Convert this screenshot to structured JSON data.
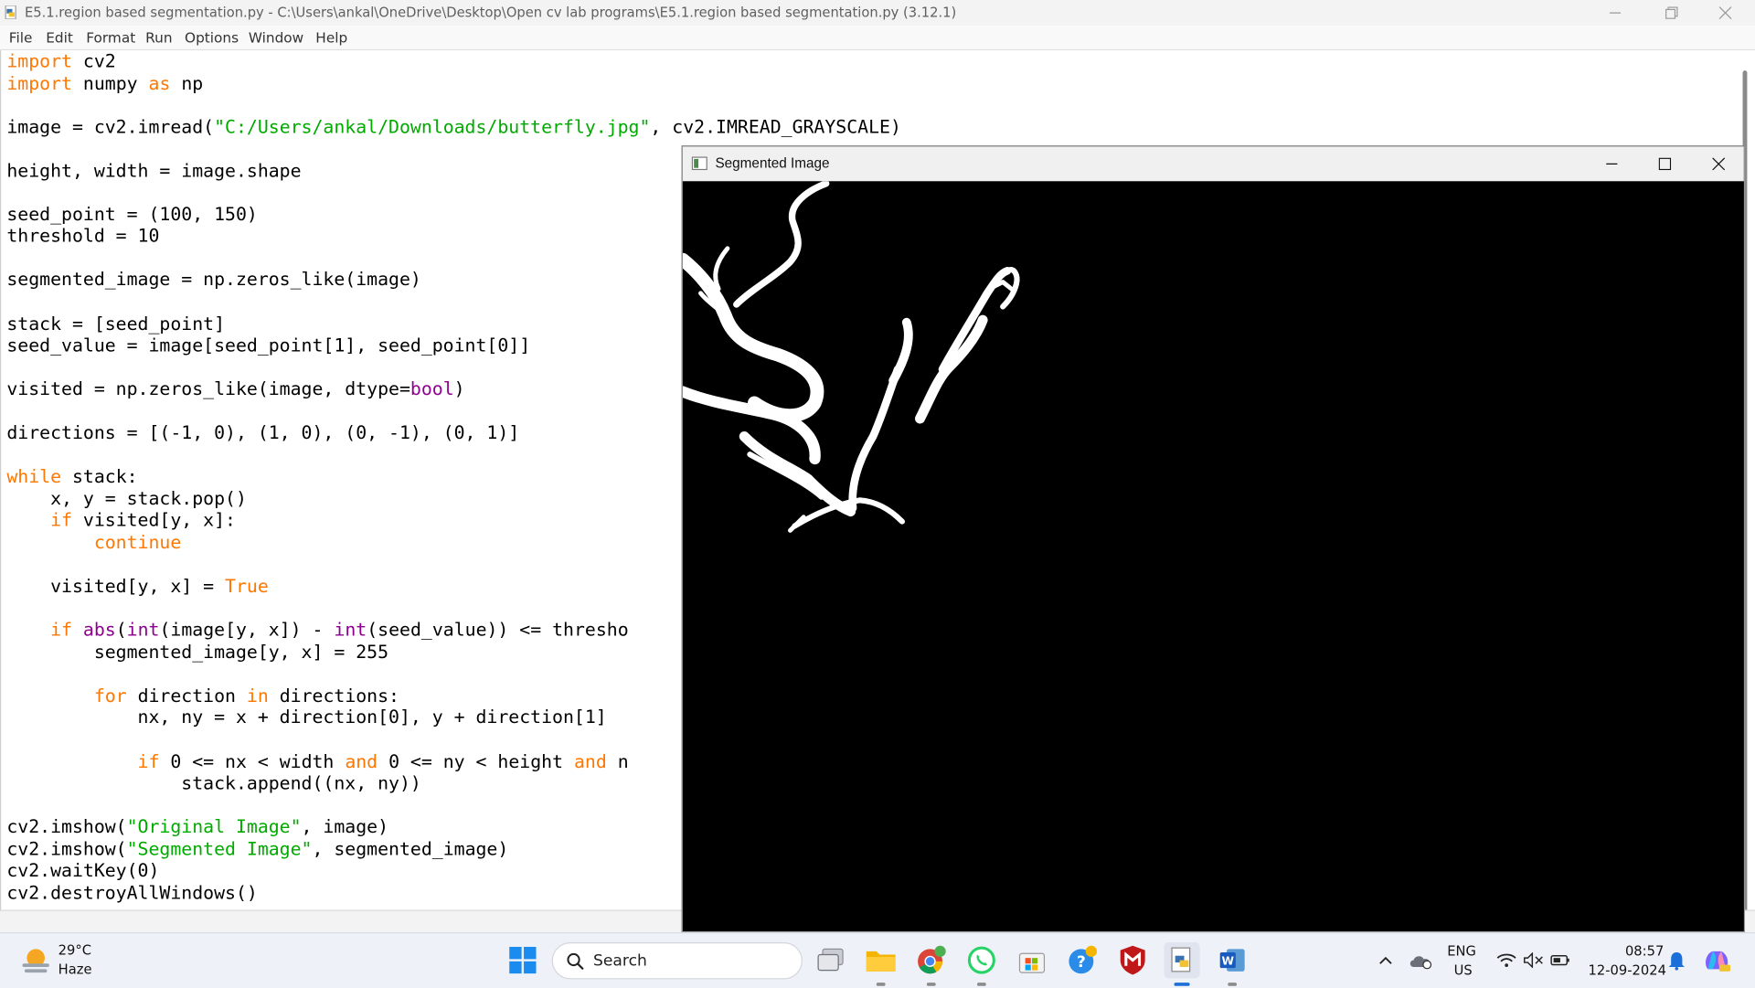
{
  "idle": {
    "title": "E5.1.region based segmentation.py - C:\\Users\\ankal\\OneDrive\\Desktop\\Open cv lab programs\\E5.1.region based segmentation.py (3.12.1)",
    "menu": [
      "File",
      "Edit",
      "Format",
      "Run",
      "Options",
      "Window",
      "Help"
    ],
    "code_lines": [
      [
        [
          "kw",
          "import"
        ],
        [
          "t",
          " cv2"
        ]
      ],
      [
        [
          "kw",
          "import"
        ],
        [
          "t",
          " numpy "
        ],
        [
          "kw",
          "as"
        ],
        [
          "t",
          " np"
        ]
      ],
      [],
      [
        [
          "t",
          "image = cv2.imread("
        ],
        [
          "st",
          "\"C:/Users/ankal/Downloads/butterfly.jpg\""
        ],
        [
          "t",
          ", cv2.IMREAD_GRAYSCALE)"
        ]
      ],
      [],
      [
        [
          "t",
          "height, width = image.shape"
        ]
      ],
      [],
      [
        [
          "t",
          "seed_point = (100, 150)"
        ]
      ],
      [
        [
          "t",
          "threshold = 10"
        ]
      ],
      [],
      [
        [
          "t",
          "segmented_image = np.zeros_like(image)"
        ]
      ],
      [],
      [
        [
          "t",
          "stack = [seed_point]"
        ]
      ],
      [
        [
          "t",
          "seed_value = image[seed_point[1], seed_point[0]]"
        ]
      ],
      [],
      [
        [
          "t",
          "visited = np.zeros_like(image, dtype="
        ],
        [
          "bi",
          "bool"
        ],
        [
          "t",
          ")"
        ]
      ],
      [],
      [
        [
          "t",
          "directions = [(-1, 0), (1, 0), (0, -1), (0, 1)]"
        ]
      ],
      [],
      [
        [
          "kw",
          "while"
        ],
        [
          "t",
          " stack:"
        ]
      ],
      [
        [
          "t",
          "    x, y = stack.pop()"
        ]
      ],
      [
        [
          "t",
          "    "
        ],
        [
          "kw",
          "if"
        ],
        [
          "t",
          " visited[y, x]:"
        ]
      ],
      [
        [
          "t",
          "        "
        ],
        [
          "kw",
          "continue"
        ]
      ],
      [],
      [
        [
          "t",
          "    visited[y, x] = "
        ],
        [
          "kw",
          "True"
        ]
      ],
      [],
      [
        [
          "t",
          "    "
        ],
        [
          "kw",
          "if"
        ],
        [
          "t",
          " "
        ],
        [
          "bi",
          "abs"
        ],
        [
          "t",
          "("
        ],
        [
          "bi",
          "int"
        ],
        [
          "t",
          "(image[y, x]) - "
        ],
        [
          "bi",
          "int"
        ],
        [
          "t",
          "(seed_value)) <= thresho"
        ]
      ],
      [
        [
          "t",
          "        segmented_image[y, x] = 255"
        ]
      ],
      [],
      [
        [
          "t",
          "        "
        ],
        [
          "kw",
          "for"
        ],
        [
          "t",
          " direction "
        ],
        [
          "kw",
          "in"
        ],
        [
          "t",
          " directions:"
        ]
      ],
      [
        [
          "t",
          "            nx, ny = x + direction[0], y + direction[1]"
        ]
      ],
      [],
      [
        [
          "t",
          "            "
        ],
        [
          "kw",
          "if"
        ],
        [
          "t",
          " 0 <= nx < width "
        ],
        [
          "kw",
          "and"
        ],
        [
          "t",
          " 0 <= ny < height "
        ],
        [
          "kw",
          "and"
        ],
        [
          "t",
          " n"
        ]
      ],
      [
        [
          "t",
          "                stack.append((nx, ny))"
        ]
      ],
      [],
      [
        [
          "t",
          "cv2.imshow("
        ],
        [
          "st",
          "\"Original Image\""
        ],
        [
          "t",
          ", image)"
        ]
      ],
      [
        [
          "t",
          "cv2.imshow("
        ],
        [
          "st",
          "\"Segmented Image\""
        ],
        [
          "t",
          ", segmented_image)"
        ]
      ],
      [
        [
          "t",
          "cv2.waitKey(0)"
        ]
      ],
      [
        [
          "t",
          "cv2.destroyAllWindows()"
        ]
      ]
    ]
  },
  "seg_window": {
    "title": "Segmented Image"
  },
  "taskbar": {
    "weather_temp": "29°C",
    "weather_cond": "Haze",
    "search_label": "Search",
    "lang_top": "ENG",
    "lang_bottom": "US",
    "time": "08:57",
    "date": "12-09-2024"
  },
  "colors": {
    "keyword": "#ff7700",
    "builtin": "#900090",
    "string": "#00aa00",
    "taskbar": "#eef1f7"
  }
}
